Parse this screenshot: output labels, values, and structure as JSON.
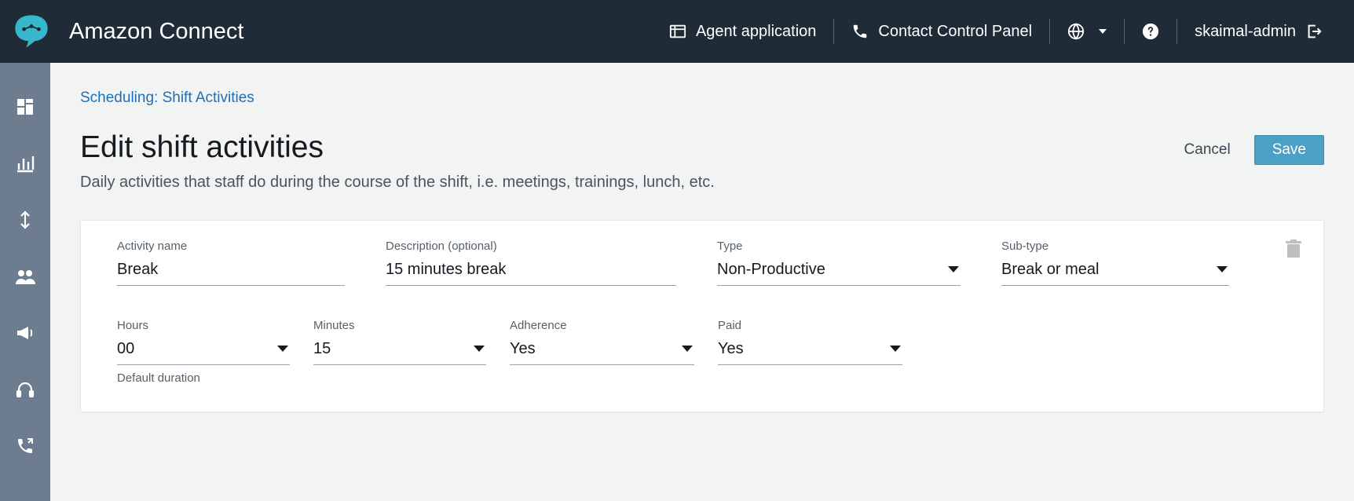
{
  "brand": "Amazon Connect",
  "top": {
    "agent_app": "Agent application",
    "ccp": "Contact Control Panel",
    "username": "skaimal-admin"
  },
  "breadcrumb": "Scheduling: Shift Activities",
  "page": {
    "title": "Edit shift activities",
    "subtitle": "Daily activities that staff do during the course of the shift, i.e. meetings, trainings, lunch, etc."
  },
  "actions": {
    "cancel": "Cancel",
    "save": "Save"
  },
  "form": {
    "activity_name": {
      "label": "Activity name",
      "value": "Break"
    },
    "description": {
      "label": "Description (optional)",
      "value": "15 minutes break"
    },
    "type": {
      "label": "Type",
      "value": "Non-Productive"
    },
    "subtype": {
      "label": "Sub-type",
      "value": "Break or meal"
    },
    "hours": {
      "label": "Hours",
      "value": "00",
      "helper": "Default duration"
    },
    "minutes": {
      "label": "Minutes",
      "value": "15"
    },
    "adherence": {
      "label": "Adherence",
      "value": "Yes"
    },
    "paid": {
      "label": "Paid",
      "value": "Yes"
    }
  }
}
